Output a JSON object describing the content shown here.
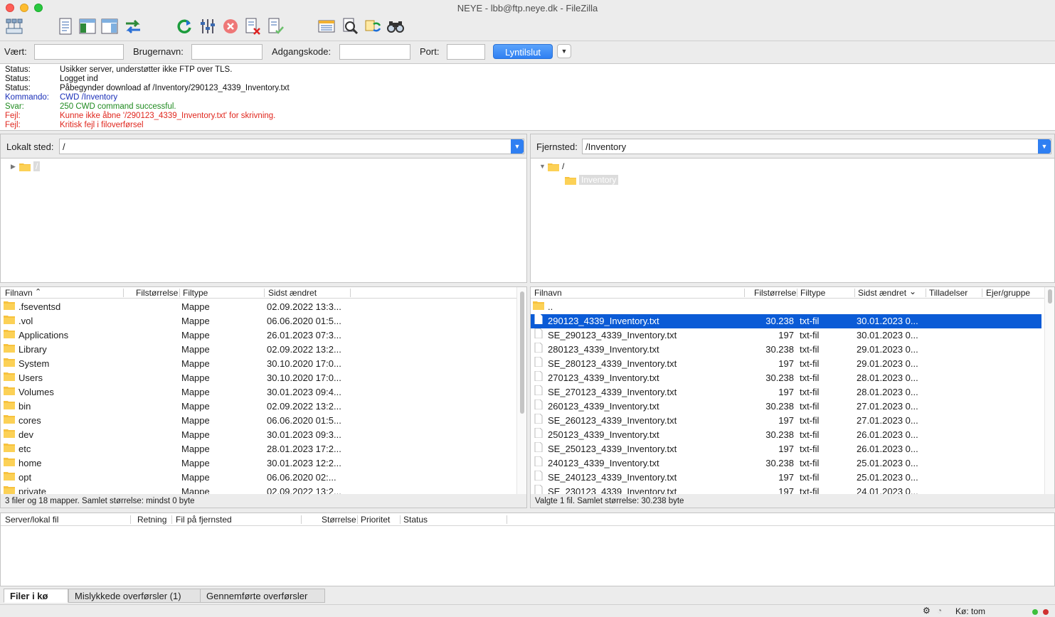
{
  "window": {
    "title": "NEYE - lbb@ftp.neye.dk - FileZilla"
  },
  "toolbar": {
    "icons": [
      "site-manager-icon",
      "toggle-log-icon",
      "toggle-local-tree-icon",
      "toggle-remote-tree-icon",
      "toggle-queue-icon",
      "refresh-icon",
      "process-queue-icon",
      "cancel-icon",
      "disconnect-icon",
      "reconnect-icon",
      "directory-listing-filter-icon",
      "compare-icon",
      "sync-browsing-icon",
      "search-icon"
    ]
  },
  "quickconnect": {
    "host_label": "Vært:",
    "host_value": "",
    "user_label": "Brugernavn:",
    "user_value": "",
    "pass_label": "Adgangskode:",
    "pass_value": "",
    "port_label": "Port:",
    "port_value": "",
    "button_label": "Lyntilslut"
  },
  "log": [
    {
      "label": "Status:",
      "message": "Usikker server, understøtter ikke FTP over TLS.",
      "type": "status"
    },
    {
      "label": "Status:",
      "message": "Logget ind",
      "type": "status"
    },
    {
      "label": "Status:",
      "message": "Påbegynder download af /Inventory/290123_4339_Inventory.txt",
      "type": "status"
    },
    {
      "label": "Kommando:",
      "message": "CWD /Inventory",
      "type": "cmd"
    },
    {
      "label": "Svar:",
      "message": "250 CWD command successful.",
      "type": "resp"
    },
    {
      "label": "Fejl:",
      "message": "Kunne ikke åbne '/290123_4339_Inventory.txt' for skrivning.",
      "type": "err"
    },
    {
      "label": "Fejl:",
      "message": "Kritisk fejl i filoverførsel",
      "type": "err"
    }
  ],
  "local": {
    "site_label": "Lokalt sted:",
    "path": "/",
    "tree_root": "/",
    "columns": [
      "Filnavn",
      "Filstørrelse",
      "Filtype",
      "Sidst ændret"
    ],
    "files": [
      {
        "name": ".fseventsd",
        "size": "",
        "type": "Mappe",
        "modified": "02.09.2022 13:3..."
      },
      {
        "name": ".vol",
        "size": "",
        "type": "Mappe",
        "modified": "06.06.2020 01:5..."
      },
      {
        "name": "Applications",
        "size": "",
        "type": "Mappe",
        "modified": "26.01.2023 07:3..."
      },
      {
        "name": "Library",
        "size": "",
        "type": "Mappe",
        "modified": "02.09.2022 13:2..."
      },
      {
        "name": "System",
        "size": "",
        "type": "Mappe",
        "modified": "30.10.2020 17:0..."
      },
      {
        "name": "Users",
        "size": "",
        "type": "Mappe",
        "modified": "30.10.2020 17:0..."
      },
      {
        "name": "Volumes",
        "size": "",
        "type": "Mappe",
        "modified": "30.01.2023 09:4..."
      },
      {
        "name": "bin",
        "size": "",
        "type": "Mappe",
        "modified": "02.09.2022 13:2..."
      },
      {
        "name": "cores",
        "size": "",
        "type": "Mappe",
        "modified": "06.06.2020 01:5..."
      },
      {
        "name": "dev",
        "size": "",
        "type": "Mappe",
        "modified": "30.01.2023 09:3..."
      },
      {
        "name": "etc",
        "size": "",
        "type": "Mappe",
        "modified": "28.01.2023 17:2..."
      },
      {
        "name": "home",
        "size": "",
        "type": "Mappe",
        "modified": "30.01.2023 12:2..."
      },
      {
        "name": "opt",
        "size": "",
        "type": "Mappe",
        "modified": "06.06.2020 02:..."
      },
      {
        "name": "private",
        "size": "",
        "type": "Mappe",
        "modified": "02.09.2022 13:2..."
      }
    ],
    "status": "3 filer og 18 mapper. Samlet størrelse: mindst 0 byte"
  },
  "remote": {
    "site_label": "Fjernsted:",
    "path": "/Inventory",
    "tree_root": "/",
    "tree_child": "Inventory",
    "columns": [
      "Filnavn",
      "Filstørrelse",
      "Filtype",
      "Sidst ændret",
      "Tilladelser",
      "Ejer/gruppe"
    ],
    "files": [
      {
        "name": "..",
        "size": "",
        "type": "",
        "modified": "",
        "folder": true
      },
      {
        "name": "290123_4339_Inventory.txt",
        "size": "30.238",
        "type": "txt-fil",
        "modified": "30.01.2023 0...",
        "selected": true
      },
      {
        "name": "SE_290123_4339_Inventory.txt",
        "size": "197",
        "type": "txt-fil",
        "modified": "30.01.2023 0..."
      },
      {
        "name": "280123_4339_Inventory.txt",
        "size": "30.238",
        "type": "txt-fil",
        "modified": "29.01.2023 0..."
      },
      {
        "name": "SE_280123_4339_Inventory.txt",
        "size": "197",
        "type": "txt-fil",
        "modified": "29.01.2023 0..."
      },
      {
        "name": "270123_4339_Inventory.txt",
        "size": "30.238",
        "type": "txt-fil",
        "modified": "28.01.2023 0..."
      },
      {
        "name": "SE_270123_4339_Inventory.txt",
        "size": "197",
        "type": "txt-fil",
        "modified": "28.01.2023 0..."
      },
      {
        "name": "260123_4339_Inventory.txt",
        "size": "30.238",
        "type": "txt-fil",
        "modified": "27.01.2023 0..."
      },
      {
        "name": "SE_260123_4339_Inventory.txt",
        "size": "197",
        "type": "txt-fil",
        "modified": "27.01.2023 0..."
      },
      {
        "name": "250123_4339_Inventory.txt",
        "size": "30.238",
        "type": "txt-fil",
        "modified": "26.01.2023 0..."
      },
      {
        "name": "SE_250123_4339_Inventory.txt",
        "size": "197",
        "type": "txt-fil",
        "modified": "26.01.2023 0..."
      },
      {
        "name": "240123_4339_Inventory.txt",
        "size": "30.238",
        "type": "txt-fil",
        "modified": "25.01.2023 0..."
      },
      {
        "name": "SE_240123_4339_Inventory.txt",
        "size": "197",
        "type": "txt-fil",
        "modified": "25.01.2023 0..."
      },
      {
        "name": "SE_230123_4339_Inventory.txt",
        "size": "197",
        "type": "txt-fil",
        "modified": "24.01.2023 0..."
      }
    ],
    "status": "Valgte 1 fil. Samlet størrelse: 30.238 byte"
  },
  "queue": {
    "columns": [
      "Server/lokal fil",
      "Retning",
      "Fil på fjernsted",
      "Størrelse",
      "Prioritet",
      "Status"
    ],
    "tabs": [
      "Filer i kø",
      "Mislykkede overførsler (1)",
      "Gennemførte overførsler"
    ],
    "status": "Kø: tom"
  },
  "colors": {
    "selection": "#0b5bd6",
    "accent": "#2f7ff2",
    "error": "#e0261d",
    "response": "#1f8a1f",
    "command": "#1a2fb8",
    "folder": "#f7c23e"
  }
}
